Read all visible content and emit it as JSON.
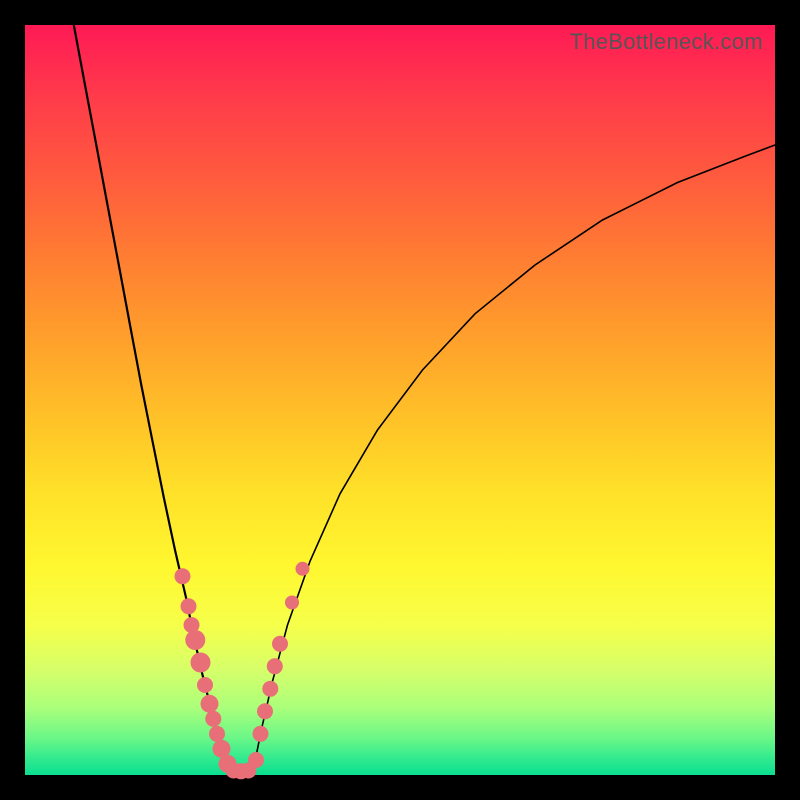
{
  "watermark": "TheBottleneck.com",
  "chart_data": {
    "type": "line",
    "title": "",
    "xlabel": "",
    "ylabel": "",
    "xlim": [
      0,
      1
    ],
    "ylim": [
      0,
      1
    ],
    "curve_left": {
      "x": [
        0.065,
        0.08,
        0.095,
        0.11,
        0.125,
        0.14,
        0.155,
        0.17,
        0.185,
        0.2,
        0.215,
        0.225,
        0.235,
        0.245,
        0.255,
        0.263,
        0.27
      ],
      "y": [
        1.0,
        0.92,
        0.84,
        0.76,
        0.68,
        0.6,
        0.52,
        0.445,
        0.37,
        0.3,
        0.235,
        0.185,
        0.14,
        0.1,
        0.06,
        0.03,
        0.01
      ]
    },
    "curve_right": {
      "x": [
        0.305,
        0.315,
        0.33,
        0.35,
        0.38,
        0.42,
        0.47,
        0.53,
        0.6,
        0.68,
        0.77,
        0.87,
        0.96,
        1.0
      ],
      "y": [
        0.01,
        0.06,
        0.125,
        0.2,
        0.285,
        0.375,
        0.46,
        0.54,
        0.615,
        0.68,
        0.74,
        0.79,
        0.825,
        0.84
      ]
    },
    "flat_bottom": {
      "x": [
        0.27,
        0.305
      ],
      "y": [
        0.004,
        0.004
      ]
    },
    "dots_left": [
      {
        "x": 0.21,
        "y": 0.265,
        "r": 8
      },
      {
        "x": 0.218,
        "y": 0.225,
        "r": 8
      },
      {
        "x": 0.222,
        "y": 0.2,
        "r": 8
      },
      {
        "x": 0.227,
        "y": 0.18,
        "r": 10
      },
      {
        "x": 0.234,
        "y": 0.15,
        "r": 10
      },
      {
        "x": 0.24,
        "y": 0.12,
        "r": 8
      },
      {
        "x": 0.246,
        "y": 0.095,
        "r": 9
      },
      {
        "x": 0.251,
        "y": 0.075,
        "r": 8
      },
      {
        "x": 0.256,
        "y": 0.055,
        "r": 8
      },
      {
        "x": 0.262,
        "y": 0.035,
        "r": 9
      },
      {
        "x": 0.27,
        "y": 0.015,
        "r": 9
      }
    ],
    "dots_bottom": [
      {
        "x": 0.278,
        "y": 0.006,
        "r": 8
      },
      {
        "x": 0.288,
        "y": 0.005,
        "r": 8
      },
      {
        "x": 0.298,
        "y": 0.006,
        "r": 8
      }
    ],
    "dots_right": [
      {
        "x": 0.308,
        "y": 0.02,
        "r": 8
      },
      {
        "x": 0.314,
        "y": 0.055,
        "r": 8
      },
      {
        "x": 0.32,
        "y": 0.085,
        "r": 8
      },
      {
        "x": 0.327,
        "y": 0.115,
        "r": 8
      },
      {
        "x": 0.333,
        "y": 0.145,
        "r": 8
      },
      {
        "x": 0.34,
        "y": 0.175,
        "r": 8
      },
      {
        "x": 0.356,
        "y": 0.23,
        "r": 7
      },
      {
        "x": 0.37,
        "y": 0.275,
        "r": 7
      }
    ]
  }
}
